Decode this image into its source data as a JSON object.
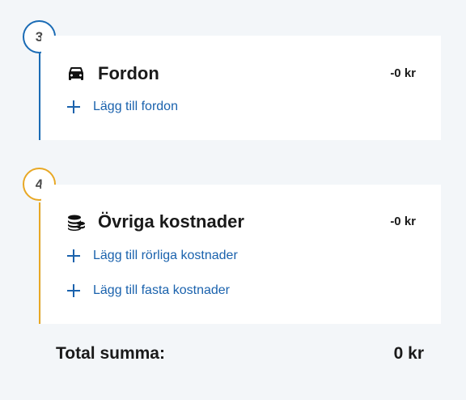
{
  "colors": {
    "step3_accent": "#1a6bb5",
    "step4_accent": "#e8a825",
    "link": "#1a62ad",
    "text": "#1a1a1a",
    "background": "#f3f6f9"
  },
  "sections": [
    {
      "step": "3",
      "icon": "car-icon",
      "title": "Fordon",
      "amount": "-0 kr",
      "links": [
        "Lägg till fordon"
      ]
    },
    {
      "step": "4",
      "icon": "coins-icon",
      "title": "Övriga kostnader",
      "amount": "-0 kr",
      "links": [
        "Lägg till rörliga kostnader",
        "Lägg till fasta kostnader"
      ]
    }
  ],
  "total": {
    "label": "Total summa:",
    "value": "0 kr"
  }
}
